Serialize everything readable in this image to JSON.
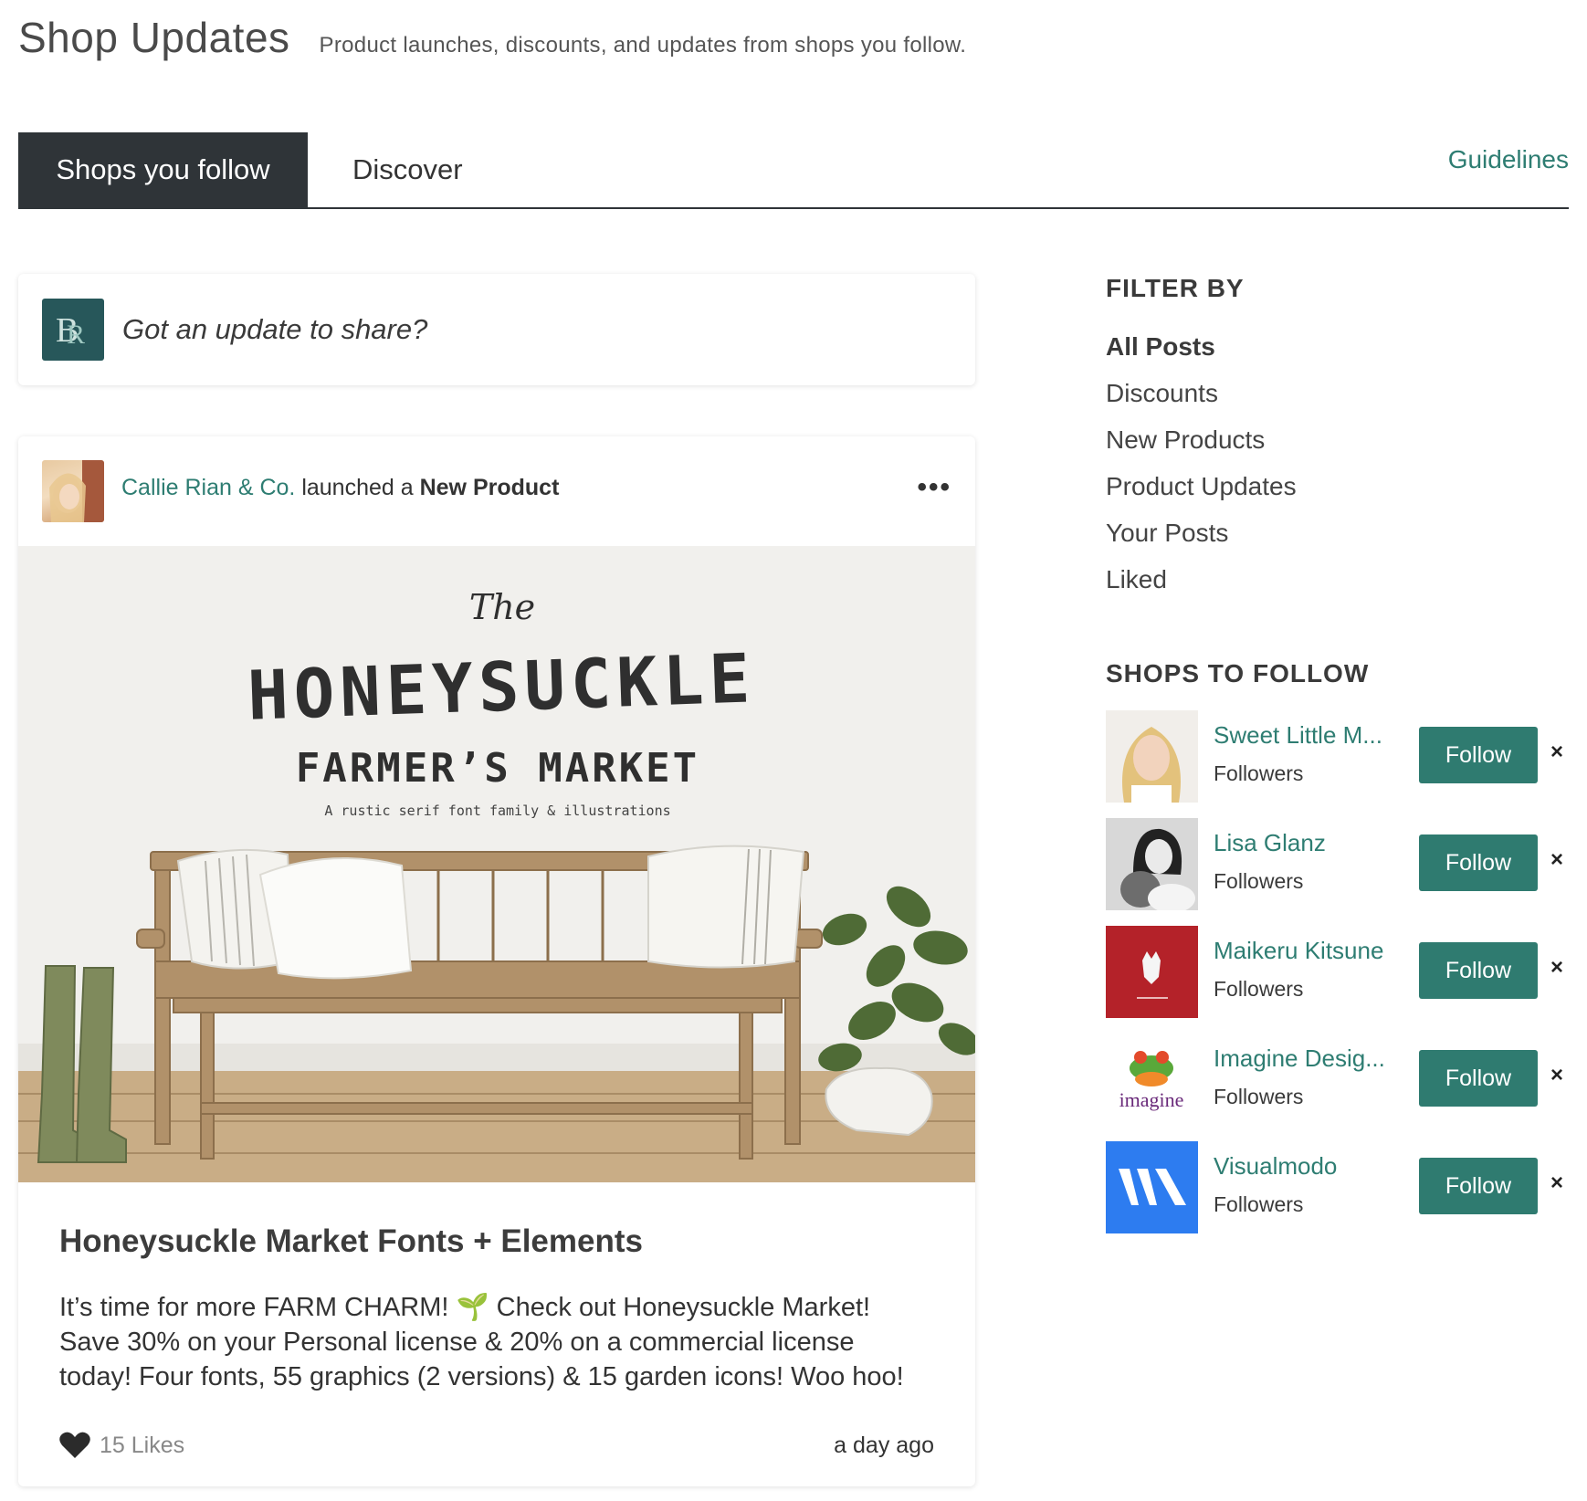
{
  "header": {
    "title": "Shop Updates",
    "subtitle": "Product launches, discounts, and updates from shops you follow."
  },
  "tabs": [
    {
      "label": "Shops you follow",
      "active": true
    },
    {
      "label": "Discover",
      "active": false
    }
  ],
  "guidelines_label": "Guidelines",
  "composer": {
    "prompt": "Got an update to share?",
    "avatar_icon": "br-monogram-icon"
  },
  "post": {
    "shop_name": "Callie Rian & Co.",
    "action_text": "launched a",
    "post_type": "New Product",
    "menu_glyph": "•••",
    "image": {
      "line1": "The",
      "line2": "HONEYSUCKLE",
      "line3": "FARMER’S MARKET",
      "line4": "A rustic serif font family & illustrations"
    },
    "title": "Honeysuckle Market Fonts + Elements",
    "body_line1": "It’s time for more FARM CHARM! 🌱  Check out Honeysuckle Market!",
    "body_line2": "Save 30% on your Personal license & 20% on a commercial license",
    "body_line3": "today! Four fonts, 55 graphics (2 versions) & 15 garden icons! Woo hoo!",
    "likes": "15 Likes",
    "time": "a day ago"
  },
  "sidebar": {
    "filter_heading": "FILTER BY",
    "filters": [
      {
        "label": "All Posts",
        "selected": true
      },
      {
        "label": "Discounts",
        "selected": false
      },
      {
        "label": "New Products",
        "selected": false
      },
      {
        "label": "Product Updates",
        "selected": false
      },
      {
        "label": "Your Posts",
        "selected": false
      },
      {
        "label": "Liked",
        "selected": false
      }
    ],
    "shops_heading": "SHOPS TO FOLLOW",
    "shops": [
      {
        "name": "Sweet Little M...",
        "followers": "Followers",
        "follow_label": "Follow",
        "dismiss": "×"
      },
      {
        "name": "Lisa Glanz",
        "followers": "Followers",
        "follow_label": "Follow",
        "dismiss": "×"
      },
      {
        "name": "Maikeru Kitsune",
        "followers": "Followers",
        "follow_label": "Follow",
        "dismiss": "×"
      },
      {
        "name": "Imagine Desig...",
        "followers": "Followers",
        "follow_label": "Follow",
        "dismiss": "×",
        "logo_text": "imagine"
      },
      {
        "name": "Visualmodo",
        "followers": "Followers",
        "follow_label": "Follow",
        "dismiss": "×"
      }
    ]
  },
  "colors": {
    "accent": "#2e7d72",
    "tab_active_bg": "#2f3438",
    "follow_button": "#2f7b70"
  }
}
